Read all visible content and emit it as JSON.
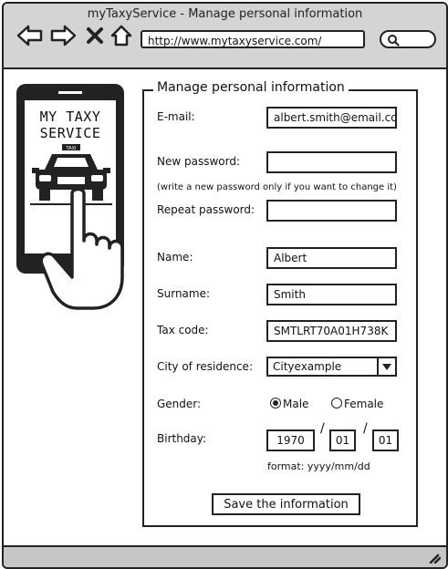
{
  "window": {
    "title": "myTaxyService - Manage personal information"
  },
  "browser": {
    "url": "http://www.mytaxyservice.com/",
    "icons": [
      "back-icon",
      "forward-icon",
      "stop-icon",
      "home-icon",
      "search-icon"
    ]
  },
  "logo": {
    "line1": "MY TAXY",
    "line2": "SERVICE",
    "sign": "TAXI"
  },
  "form": {
    "legend": "Manage personal information",
    "email_label": "E-mail:",
    "email_value": "albert.smith@email.co",
    "new_password_label": "New password:",
    "password_hint": "(write a new password only if you want to change it)",
    "repeat_password_label": "Repeat password:",
    "name_label": "Name:",
    "name_value": "Albert",
    "surname_label": "Surname:",
    "surname_value": "Smith",
    "taxcode_label": "Tax code:",
    "taxcode_value": "SMTLRT70A01H738K",
    "city_label": "City of residence:",
    "city_value": "Cityexample",
    "gender_label": "Gender:",
    "gender_male": "Male",
    "gender_female": "Female",
    "birthday_label": "Birthday:",
    "birth_year": "1970",
    "birth_month": "01",
    "birth_day": "01",
    "date_separator": "/",
    "format_hint": "format: yyyy/mm/dd",
    "save_label": "Save the information"
  }
}
